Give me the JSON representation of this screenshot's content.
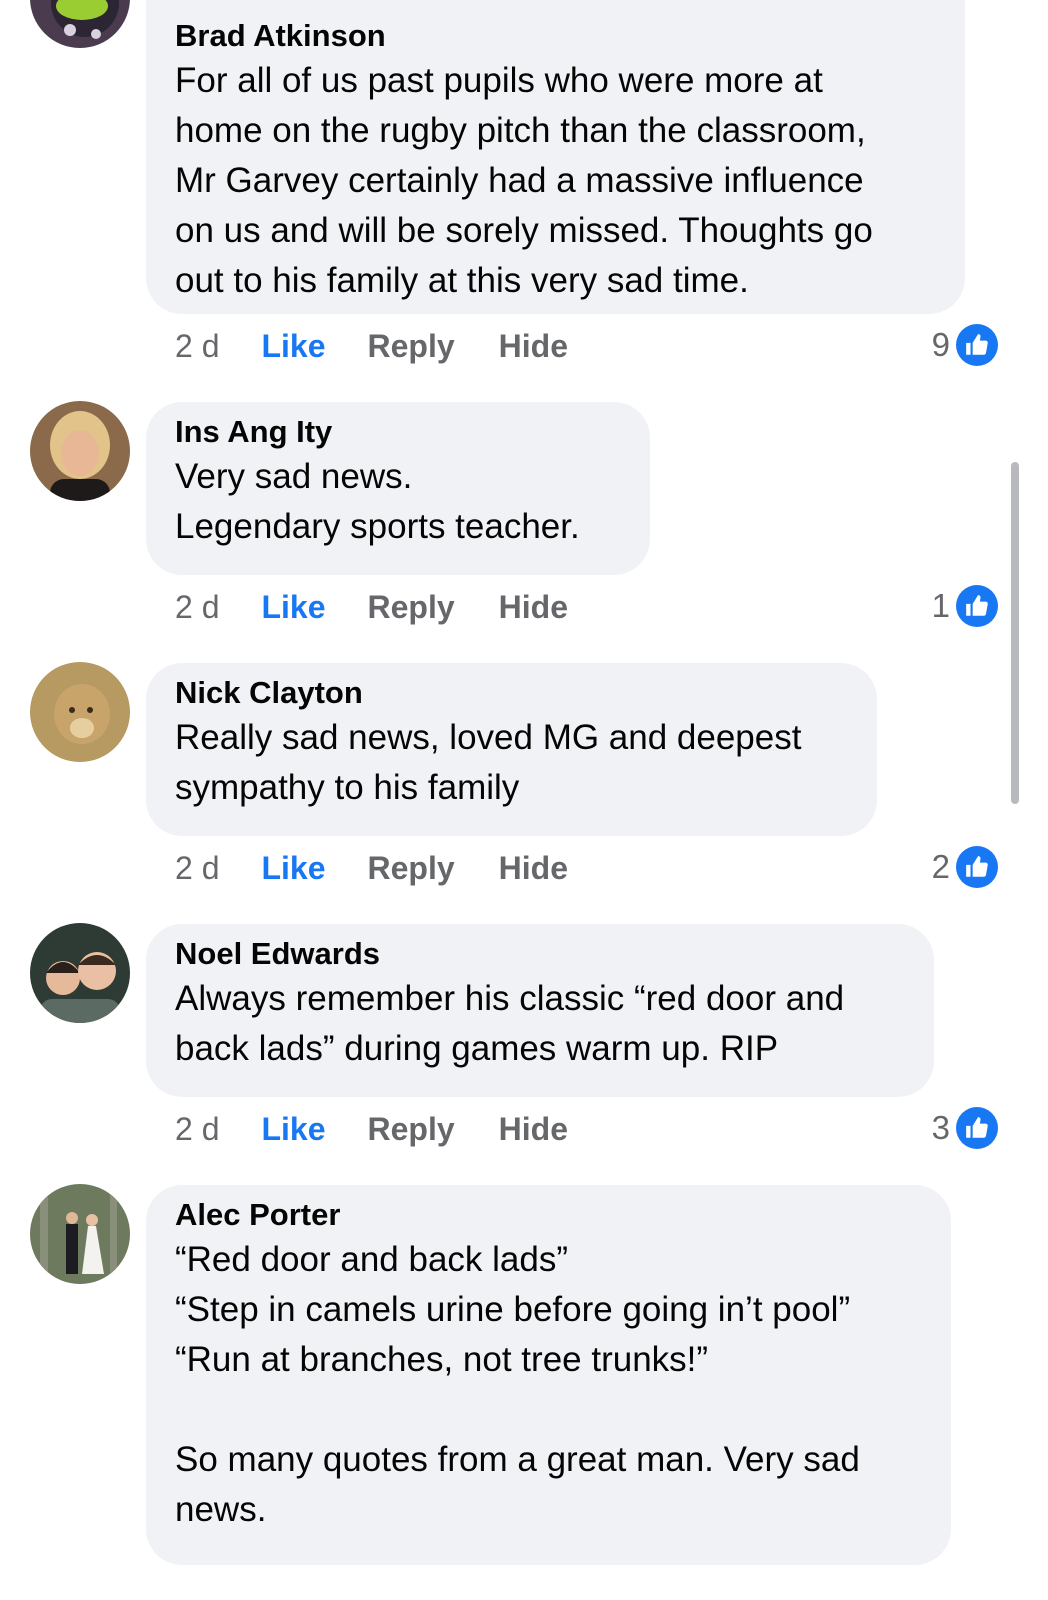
{
  "colors": {
    "like_blue": "#1877f2",
    "bubble_bg": "#f0f2f5",
    "meta_gray": "#65676b"
  },
  "comments": [
    {
      "author": "Brad Atkinson",
      "text": "For all of us past pupils who were more at\nhome on the rugby pitch than the classroom,\nMr Garvey certainly had a massive influence\non us and will be sorely missed. Thoughts go\nout to his family at this very sad time.",
      "time": "2 d",
      "like_label": "Like",
      "reply_label": "Reply",
      "hide_label": "Hide",
      "reaction_count": "9",
      "reaction_icon": "thumbs-up-icon"
    },
    {
      "author": "Ins Ang Ity",
      "text": "Very sad news.\nLegendary sports teacher.",
      "time": "2 d",
      "like_label": "Like",
      "reply_label": "Reply",
      "hide_label": "Hide",
      "reaction_count": "1",
      "reaction_icon": "thumbs-up-icon"
    },
    {
      "author": "Nick Clayton",
      "text": "Really sad news, loved MG and deepest\nsympathy to his family",
      "time": "2 d",
      "like_label": "Like",
      "reply_label": "Reply",
      "hide_label": "Hide",
      "reaction_count": "2",
      "reaction_icon": "thumbs-up-icon"
    },
    {
      "author": "Noel Edwards",
      "text": "Always remember his classic “red door and\nback lads” during games warm up. RIP",
      "time": "2 d",
      "like_label": "Like",
      "reply_label": "Reply",
      "hide_label": "Hide",
      "reaction_count": "3",
      "reaction_icon": "thumbs-up-icon"
    },
    {
      "author": "Alec Porter",
      "text": "“Red door and back lads”\n“Step in camels urine before going in’t pool”\n“Run at branches, not tree trunks!”\n\nSo many quotes from a great man. Very sad\nnews."
    }
  ]
}
